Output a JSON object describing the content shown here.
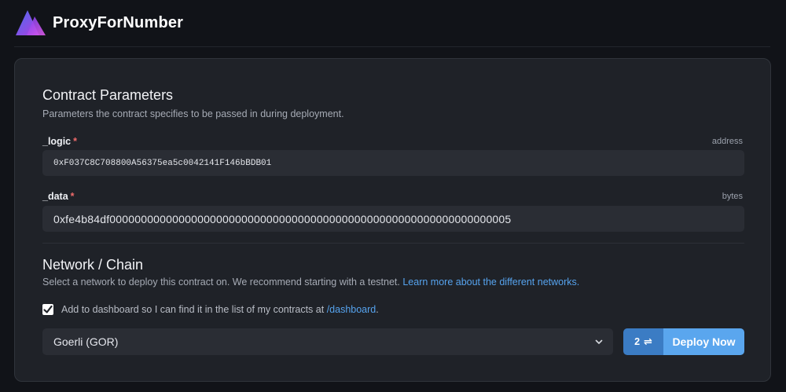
{
  "header": {
    "title": "ProxyForNumber",
    "logo_icon": "gradient-triangle-logo-icon"
  },
  "contract_parameters": {
    "title": "Contract Parameters",
    "description": "Parameters the contract specifies to be passed in during deployment.",
    "fields": [
      {
        "label": "_logic",
        "required_marker": "*",
        "type": "address",
        "value": "0xF037C8C708800A56375ea5c0042141F146bBDB01"
      },
      {
        "label": "_data",
        "required_marker": "*",
        "type": "bytes",
        "value": "0xfe4b84df0000000000000000000000000000000000000000000000000000000000000005"
      }
    ]
  },
  "network": {
    "title": "Network / Chain",
    "description": "Select a network to deploy this contract on. We recommend starting with a testnet.",
    "learn_more_link": "Learn more about the different networks.",
    "checkbox_checked": true,
    "checkbox_label": "Add to dashboard so I can find it in the list of my contracts at",
    "dashboard_link": "/dashboard",
    "checkbox_label_suffix": ".",
    "selected_network": "Goerli (GOR)"
  },
  "deploy": {
    "count": "2",
    "count_icon": "swap-arrows-icon",
    "button_label": "Deploy Now"
  },
  "colors": {
    "background": "#111318",
    "card": "#1f2228",
    "input": "#2a2d34",
    "accent": "#5aa6ee",
    "accent_dark": "#3b7cc4",
    "required": "#ef6b6b",
    "link": "#56a3ee"
  }
}
